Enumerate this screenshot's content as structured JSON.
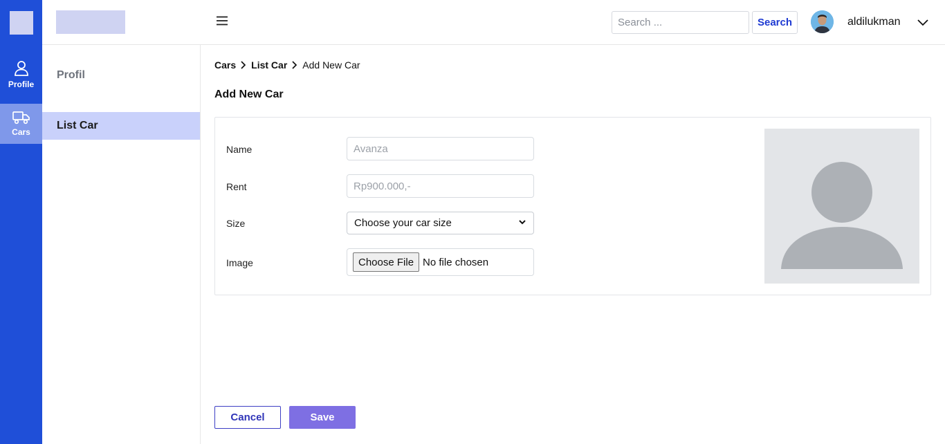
{
  "rail": {
    "items": [
      {
        "label": "Profile",
        "icon": "user-icon"
      },
      {
        "label": "Cars",
        "icon": "truck-icon"
      }
    ]
  },
  "topbar": {
    "search_placeholder": "Search ...",
    "search_label": "Search",
    "username": "aldilukman"
  },
  "subnav": {
    "items": [
      {
        "label": "Profil"
      },
      {
        "label": "List Car"
      }
    ]
  },
  "breadcrumb": [
    "Cars",
    "List Car",
    "Add New Car"
  ],
  "page": {
    "title": "Add New Car"
  },
  "form": {
    "name_label": "Name",
    "name_placeholder": "Avanza",
    "rent_label": "Rent",
    "rent_placeholder": "Rp900.000,-",
    "size_label": "Size",
    "size_selected": "Choose your car size",
    "image_label": "Image",
    "file_button": "Choose File",
    "file_status": "No file chosen"
  },
  "actions": {
    "cancel": "Cancel",
    "save": "Save"
  },
  "colors": {
    "rail_bg": "#1f4fd8",
    "active_rail": "#7f98ea",
    "active_subnav": "#c9d1fb",
    "primary_text": "#1e3ad2",
    "save_bg": "#7e6fe3"
  }
}
